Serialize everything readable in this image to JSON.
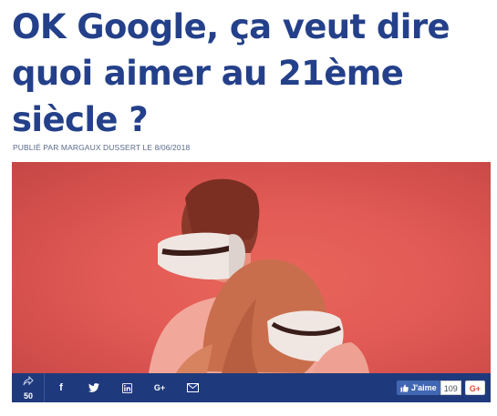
{
  "article": {
    "title_lines": [
      "OK Google, ça veut dire",
      "quoi aimer au 21ème",
      "siècle ?"
    ],
    "byline": "PUBLIÉ PAR MARGAUX DUSSERT LE 8/06/2018"
  },
  "share_bar": {
    "share_count": "50",
    "buttons": [
      {
        "label": "f",
        "icon": "facebook-icon"
      },
      {
        "label": "",
        "icon": "twitter-icon"
      },
      {
        "label": "",
        "icon": "linkedin-icon"
      },
      {
        "label": "G+",
        "icon": "google-plus-icon"
      },
      {
        "label": "",
        "icon": "email-icon"
      }
    ],
    "fb_like_label": "J'aime",
    "fb_like_count": "109",
    "gplus_label": "G+"
  },
  "colors": {
    "title": "#24408a",
    "share_bar": "#1f3a7c",
    "hero_bg": "#e25a55"
  }
}
